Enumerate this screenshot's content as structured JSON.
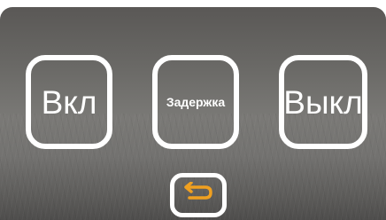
{
  "buttons": {
    "on_label": "Вкл",
    "delay_label": "Задержка",
    "off_label": "Выкл"
  },
  "back": {
    "icon": "return-arrow-icon"
  },
  "colors": {
    "accent": "#f0a020",
    "button_border": "#ffffff",
    "text": "#ffffff"
  }
}
